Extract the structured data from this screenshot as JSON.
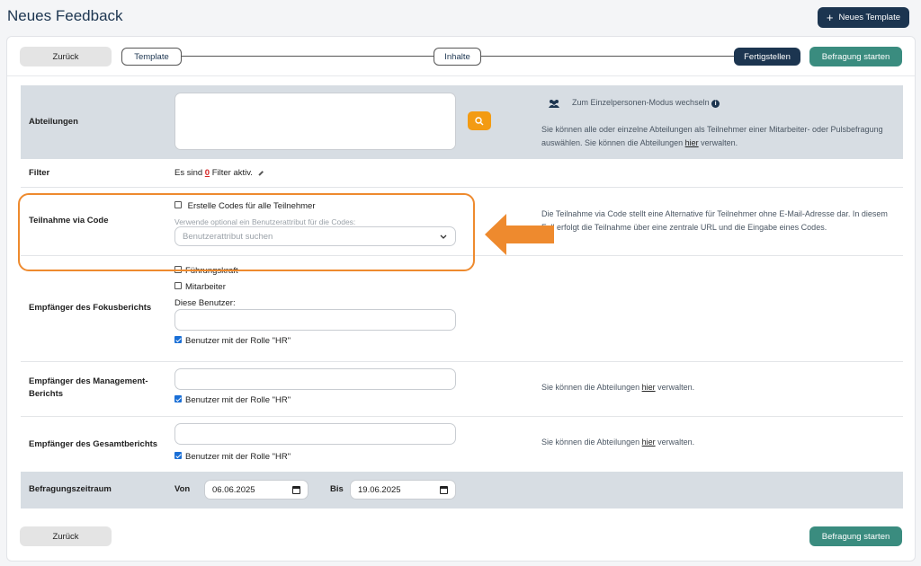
{
  "header": {
    "title": "Neues Feedback",
    "new_template": "Neues Template"
  },
  "nav": {
    "back": "Zurück",
    "steps": [
      "Template",
      "Inhalte",
      "Fertigstellen"
    ],
    "start": "Befragung starten"
  },
  "rows": {
    "abteilungen": {
      "label": "Abteilungen",
      "mode_switch": "Zum Einzelpersonen-Modus wechseln",
      "help_pre": "Sie können alle oder einzelne Abteilungen als Teilnehmer einer Mitarbeiter- oder Pulsbefragung auswählen. Sie können die Abteilungen ",
      "help_link": "hier",
      "help_post": " verwalten."
    },
    "filter": {
      "label": "Filter",
      "pre": "Es sind ",
      "count": "0",
      "post": " Filter aktiv."
    },
    "code": {
      "label": "Teilnahme via Code",
      "checkbox": "Erstelle Codes für alle Teilnehmer",
      "hint": "Verwende optional ein Benutzerattribut für die Codes:",
      "select_placeholder": "Benutzerattribut suchen",
      "help": "Die Teilnahme via Code stellt eine Alternative für Teilnehmer ohne E-Mail-Adresse dar. In diesem Fall erfolgt die Teilnahme über eine zentrale URL und die Eingabe eines Codes."
    },
    "fokus": {
      "label": "Empfänger des Fokusberichts",
      "opt1": "Führungskraft",
      "opt2": "Mitarbeiter",
      "users_label": "Diese Benutzer:",
      "hr": "Benutzer mit der Rolle \"HR\""
    },
    "management": {
      "label": "Empfänger des Management-Berichts",
      "hr": "Benutzer mit der Rolle \"HR\"",
      "help_pre": "Sie können die Abteilungen ",
      "help_link": "hier",
      "help_post": " verwalten."
    },
    "gesamt": {
      "label": "Empfänger des Gesamtberichts",
      "hr": "Benutzer mit der Rolle \"HR\"",
      "help_pre": "Sie können die Abteilungen ",
      "help_link": "hier",
      "help_post": " verwalten."
    },
    "zeitraum": {
      "label": "Befragungszeitraum",
      "von_label": "Von",
      "von": "06.06.2025",
      "bis_label": "Bis",
      "bis": "19.06.2025"
    }
  },
  "footer": {
    "back": "Zurück",
    "start": "Befragung starten"
  },
  "colors": {
    "primary": "#1c3550",
    "accent_green": "#3a8c7f",
    "search_orange": "#f39b13",
    "highlight_orange": "#ee8a2e",
    "checkbox_blue": "#1a6fd6"
  }
}
